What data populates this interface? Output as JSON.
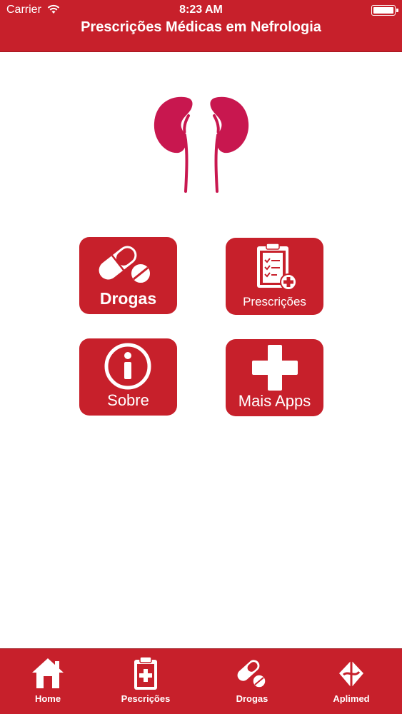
{
  "status_bar": {
    "carrier": "Carrier",
    "time": "8:23 AM"
  },
  "nav": {
    "title": "Prescrições Médicas em Nefrologia"
  },
  "tiles": [
    {
      "label": "Drogas",
      "icon": "pill-icon"
    },
    {
      "label": "Prescrições",
      "icon": "clipboard-icon"
    },
    {
      "label": "Sobre",
      "icon": "info-icon"
    },
    {
      "label": "Mais Apps",
      "icon": "plus-icon"
    }
  ],
  "tabs": [
    {
      "label": "Home",
      "icon": "home-icon"
    },
    {
      "label": "Pescrições",
      "icon": "clipboard-plus-icon"
    },
    {
      "label": "Drogas",
      "icon": "pill-icon"
    },
    {
      "label": "Aplimed",
      "icon": "aplimed-logo-icon"
    }
  ],
  "colors": {
    "brand_red": "#c7202b",
    "kidney": "#c8174f",
    "background": "#ffffff"
  }
}
